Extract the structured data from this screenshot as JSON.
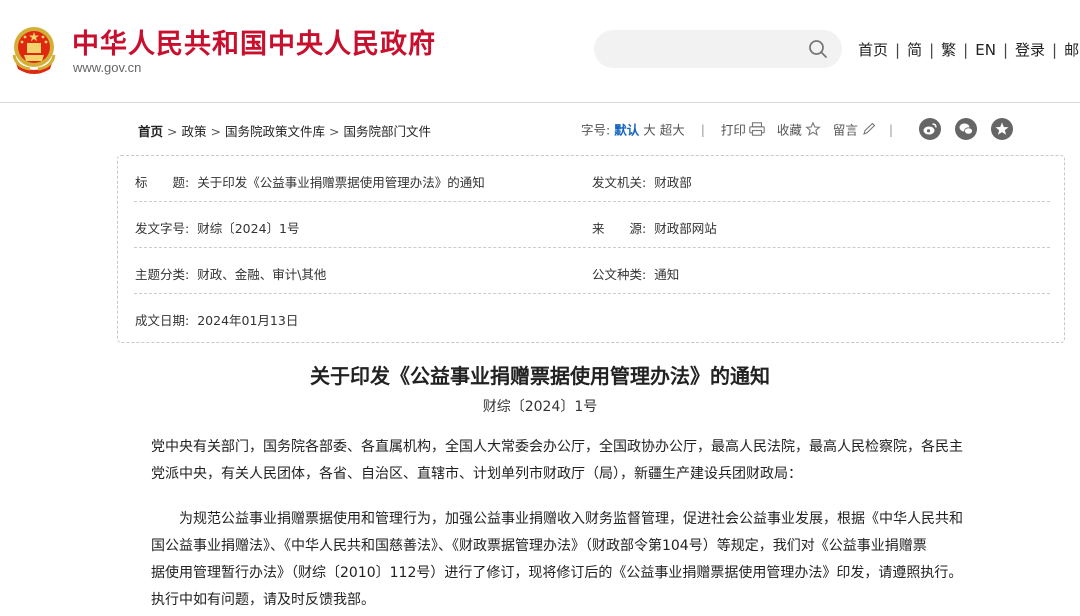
{
  "header": {
    "site_title": "中华人民共和国中央人民政府",
    "site_domain": "www.gov.cn",
    "search_placeholder": "",
    "nav": [
      "首页",
      "简",
      "繁",
      "EN",
      "登录",
      "邮"
    ]
  },
  "breadcrumb": {
    "items": [
      "首页",
      "政策",
      "国务院政策文件库",
      "国务院部门文件"
    ],
    "separator": ">"
  },
  "tools": {
    "font_size_label": "字号:",
    "font_default": "默认",
    "font_large": "大",
    "font_xlarge": "超大",
    "print": "打印",
    "favorite": "收藏",
    "comment": "留言",
    "social_icons": [
      "weibo-icon",
      "wechat-icon",
      "star-share-icon"
    ]
  },
  "info": {
    "title_key": "标　　题:",
    "title_val": "关于印发《公益事业捐赠票据使用管理办法》的通知",
    "issuer_key": "发文机关:",
    "issuer_val": "财政部",
    "docno_key": "发文字号:",
    "docno_val": "财综〔2024〕1号",
    "source_key": "来　　源:",
    "source_val": "财政部网站",
    "topic_key": "主题分类:",
    "topic_val": "财政、金融、审计\\其他",
    "type_key": "公文种类:",
    "type_val": "通知",
    "date_key": "成文日期:",
    "date_val": "2024年01月13日"
  },
  "article": {
    "title": "关于印发《公益事业捐赠票据使用管理办法》的通知",
    "doc_no": "财综〔2024〕1号",
    "p1_lines": [
      "党中央有关部门，国务院各部委、各直属机构，全国人大常委会办公厅，全国政协办公厅，最高人民法院，最高人民检察院，各民主",
      "党派中央，有关人民团体，各省、自治区、直辖市、计划单列市财政厅（局），新疆生产建设兵团财政局："
    ],
    "p2_lines": [
      "为规范公益事业捐赠票据使用和管理行为，加强公益事业捐赠收入财务监督管理，促进社会公益事业发展，根据《中华人民共和",
      "国公益事业捐赠法》、《中华人民共和国慈善法》、《财政票据管理办法》（财政部令第104号）等规定，我们对《公益事业捐赠票",
      "据使用管理暂行办法》（财综〔2010〕112号）进行了修订，现将修订后的《公益事业捐赠票据使用管理办法》印发，请遵照执行。",
      "执行中如有问题，请及时反馈我部。"
    ]
  },
  "colors": {
    "brand_red": "#c8102e",
    "link_blue": "#1565c0"
  }
}
